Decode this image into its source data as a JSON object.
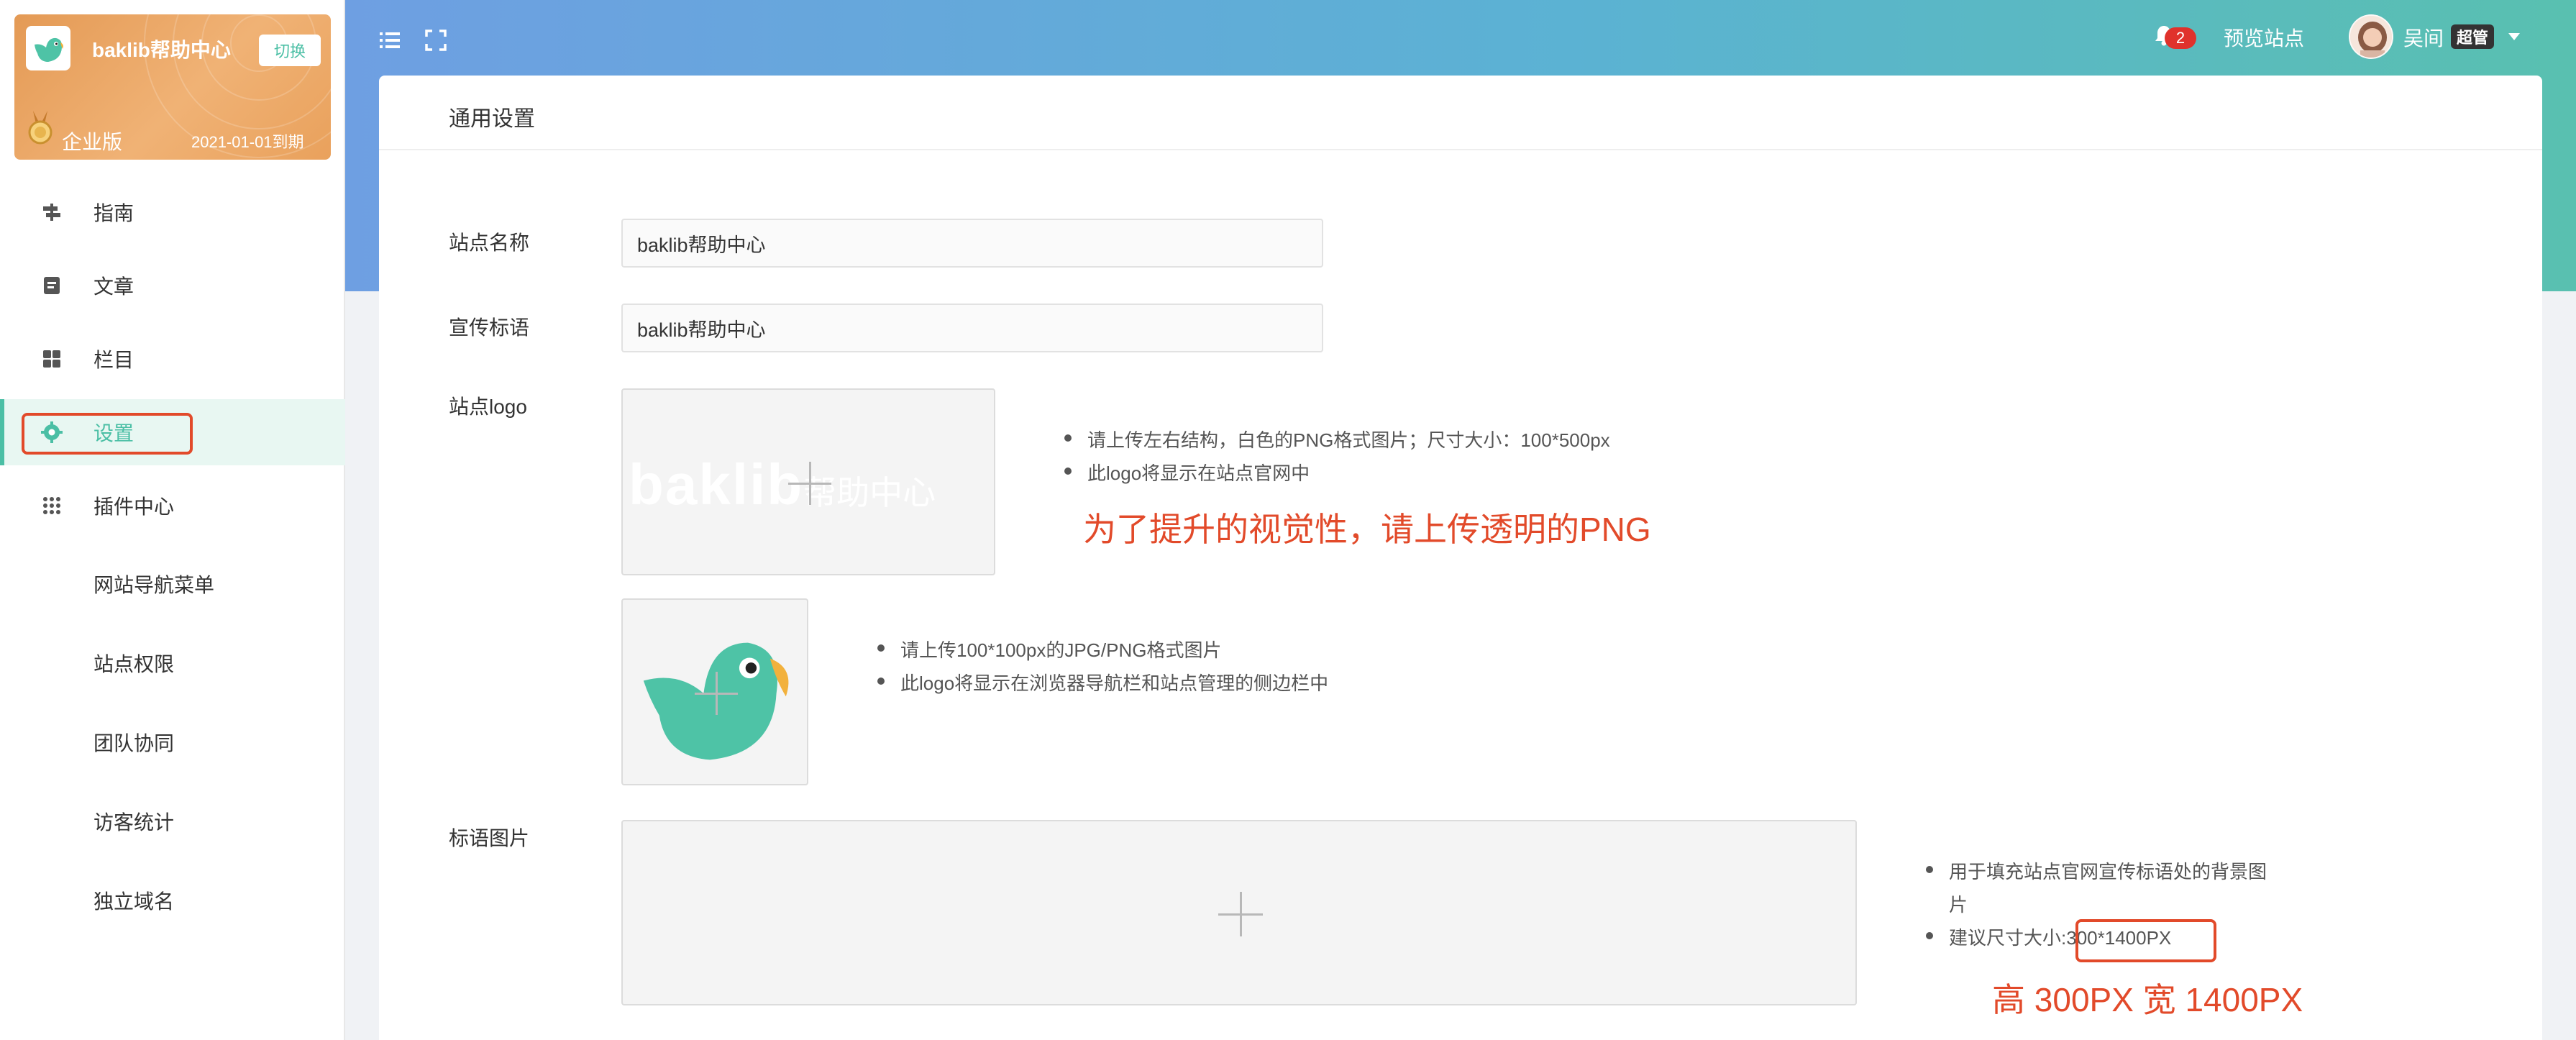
{
  "brand": {
    "name": "baklib帮助中心",
    "switch_label": "切换",
    "edition": "企业版",
    "expiry": "2021-01-01到期"
  },
  "sidebar": {
    "items": [
      {
        "label": "指南",
        "icon": "signpost-icon"
      },
      {
        "label": "文章",
        "icon": "document-icon"
      },
      {
        "label": "栏目",
        "icon": "grid-icon"
      },
      {
        "label": "设置",
        "icon": "gear-icon",
        "active": true
      },
      {
        "label": "插件中心",
        "icon": "apps-dots-icon"
      }
    ],
    "sub_items": [
      "网站导航菜单",
      "站点权限",
      "团队协同",
      "访客统计",
      "独立域名"
    ]
  },
  "header": {
    "notification_count": "2",
    "preview_label": "预览站点",
    "user_name": "吴间",
    "user_role": "超管"
  },
  "main": {
    "title": "通用设置",
    "fields": {
      "site_name": {
        "label": "站点名称",
        "value": "baklib帮助中心"
      },
      "slogan": {
        "label": "宣传标语",
        "value": "baklib帮助中心"
      },
      "logo": {
        "label": "站点logo",
        "preview_text": "baklib",
        "preview_text_cn": "帮助中心",
        "hints": [
          "请上传左右结构，白色的PNG格式图片；尺寸大小：100*500px",
          "此logo将显示在站点官网中"
        ],
        "annotation": "为了提升的视觉性，请上传透明的PNG"
      },
      "icon": {
        "hints": [
          "请上传100*100px的JPG/PNG格式图片",
          "此logo将显示在浏览器导航栏和站点管理的侧边栏中"
        ]
      },
      "banner": {
        "label": "标语图片",
        "hint1_line1": "用于填充站点官网宣传标语处的背景图",
        "hint1_line2": "片",
        "hint2_prefix": "建议尺寸大小:",
        "hint2_size": "300*1400PX",
        "annotation": "高 300PX 宽 1400PX"
      }
    }
  },
  "colors": {
    "accent": "#4bbfa5",
    "annotation_red": "#e24a2a",
    "brand_card": "#e9a15c",
    "header_left": "#6e9fe2",
    "header_right": "#59c0b0"
  }
}
